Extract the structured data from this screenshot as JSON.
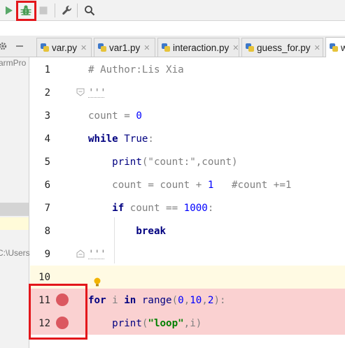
{
  "toolbar": {
    "buttons": [
      {
        "name": "run-icon",
        "color": "#59a869"
      },
      {
        "name": "debug-icon",
        "color": "#499c54"
      },
      {
        "name": "stop-icon",
        "color": "#c8c8c8"
      },
      {
        "name": "wrench-icon",
        "color": "#555555"
      },
      {
        "name": "search-icon",
        "color": "#555555"
      }
    ],
    "highlight_color": "#e3161b"
  },
  "left_panel": {
    "project_text": "armPro",
    "path_text": "C:\\Users"
  },
  "tabs": [
    {
      "label": "var.py"
    },
    {
      "label": "var1.py"
    },
    {
      "label": "interaction.py"
    },
    {
      "label": "guess_for.py"
    },
    {
      "label": "w"
    }
  ],
  "editor": {
    "line_numbers": [
      "1",
      "2",
      "3",
      "4",
      "5",
      "6",
      "7",
      "8",
      "9",
      "10",
      "11",
      "12"
    ],
    "breakpoint_lines": [
      "11",
      "12"
    ],
    "breakpoint_color": "#db5860",
    "breakpoint_line_bg": "#fad1d1",
    "lines": [
      [
        {
          "t": "# Author:Lis Xia",
          "c": "cm"
        }
      ],
      [
        {
          "t": "'''",
          "c": "cm"
        }
      ],
      [
        {
          "t": "count = ",
          "c": "tx"
        },
        {
          "t": "0",
          "c": "nm"
        }
      ],
      [
        {
          "t": "while ",
          "c": "kw"
        },
        {
          "t": "True",
          "c": "bi"
        },
        {
          "t": ":",
          "c": "tx"
        }
      ],
      [
        {
          "t": "    print",
          "c": "bi"
        },
        {
          "t": "(\"count:\",count)",
          "c": "tx"
        }
      ],
      [
        {
          "t": "    count = count + ",
          "c": "tx"
        },
        {
          "t": "1",
          "c": "nm"
        },
        {
          "t": "   #count +=1",
          "c": "cm"
        }
      ],
      [
        {
          "t": "    if ",
          "c": "kw"
        },
        {
          "t": "count == ",
          "c": "tx"
        },
        {
          "t": "1000",
          "c": "nm"
        },
        {
          "t": ":",
          "c": "tx"
        }
      ],
      [
        {
          "t": "        break",
          "c": "kw"
        }
      ],
      [
        {
          "t": "'''",
          "c": "cm"
        }
      ],
      [
        {
          "t": "",
          "c": "tx"
        }
      ],
      [
        {
          "t": "for ",
          "c": "kw"
        },
        {
          "t": "i ",
          "c": "tx"
        },
        {
          "t": "in ",
          "c": "kw"
        },
        {
          "t": "range",
          "c": "bi"
        },
        {
          "t": "(",
          "c": "tx"
        },
        {
          "t": "0",
          "c": "nm"
        },
        {
          "t": ",",
          "c": "tx"
        },
        {
          "t": "10",
          "c": "nm"
        },
        {
          "t": ",",
          "c": "tx"
        },
        {
          "t": "2",
          "c": "nm"
        },
        {
          "t": "):",
          "c": "tx"
        }
      ],
      [
        {
          "t": "    print",
          "c": "bi"
        },
        {
          "t": "(",
          "c": "tx"
        },
        {
          "t": "\"loop\"",
          "c": "st"
        },
        {
          "t": ",i)",
          "c": "tx"
        }
      ]
    ]
  }
}
